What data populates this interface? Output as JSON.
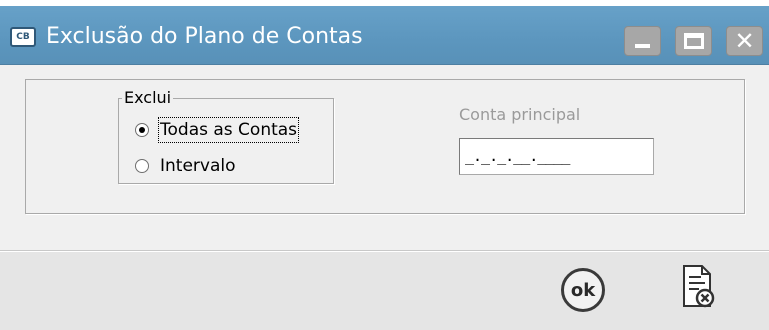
{
  "window": {
    "app_icon_text": "CB",
    "title": "Exclusão do Plano de Contas",
    "controls": [
      "minimize-icon",
      "maximize-icon",
      "close-icon"
    ]
  },
  "group": {
    "legend": "Exclui",
    "options": [
      {
        "label": "Todas as Contas",
        "selected": true
      },
      {
        "label": "Intervalo",
        "selected": false
      }
    ]
  },
  "conta_principal": {
    "label": "Conta principal",
    "value": "_._._.__.____"
  },
  "footer": {
    "ok_label": "ok",
    "cancel_icon": "document-cancel-icon"
  },
  "colors": {
    "titlebar": "#5c96be",
    "window_buttons": "#a7a7a7",
    "disabled_text": "#9a9a9a",
    "footer_bg": "#e5e5e5"
  }
}
